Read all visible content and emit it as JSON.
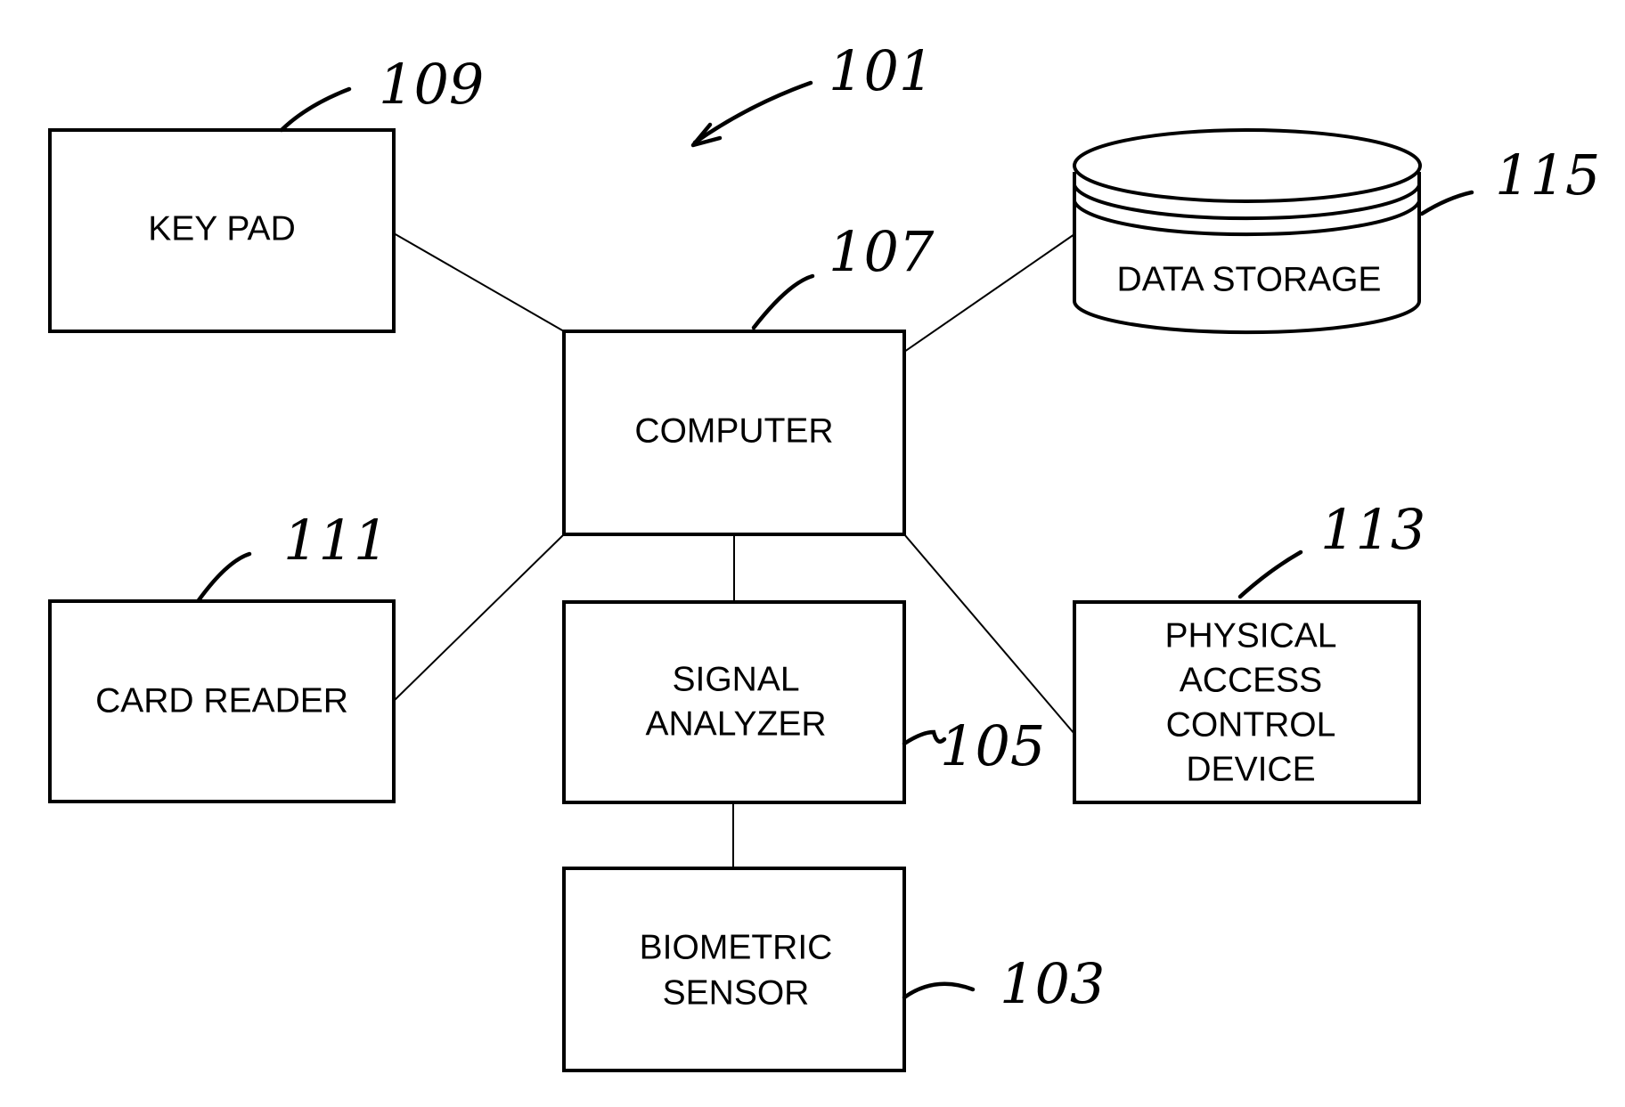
{
  "figure": {
    "reference": "101",
    "colors": {
      "ink": "#000000",
      "background": "#ffffff"
    }
  },
  "blocks": [
    {
      "id": "keypad",
      "label": [
        "KEY PAD"
      ],
      "ref": "109"
    },
    {
      "id": "computer",
      "label": [
        "COMPUTER"
      ],
      "ref": "107"
    },
    {
      "id": "data-storage",
      "label": [
        "DATA STORAGE"
      ],
      "ref": "115",
      "shape": "cylinder"
    },
    {
      "id": "card-reader",
      "label": [
        "CARD READER"
      ],
      "ref": "111"
    },
    {
      "id": "signal-analyzer",
      "label": [
        "SIGNAL",
        "ANALYZER"
      ],
      "ref": "105"
    },
    {
      "id": "physical-access",
      "label": [
        "PHYSICAL",
        "ACCESS",
        "CONTROL",
        "DEVICE"
      ],
      "ref": "113"
    },
    {
      "id": "biometric-sensor",
      "label": [
        "BIOMETRIC",
        "SENSOR"
      ],
      "ref": "103"
    }
  ],
  "connections": [
    [
      "keypad",
      "computer"
    ],
    [
      "data-storage",
      "computer"
    ],
    [
      "card-reader",
      "computer"
    ],
    [
      "signal-analyzer",
      "computer"
    ],
    [
      "physical-access",
      "computer"
    ],
    [
      "biometric-sensor",
      "signal-analyzer"
    ]
  ]
}
